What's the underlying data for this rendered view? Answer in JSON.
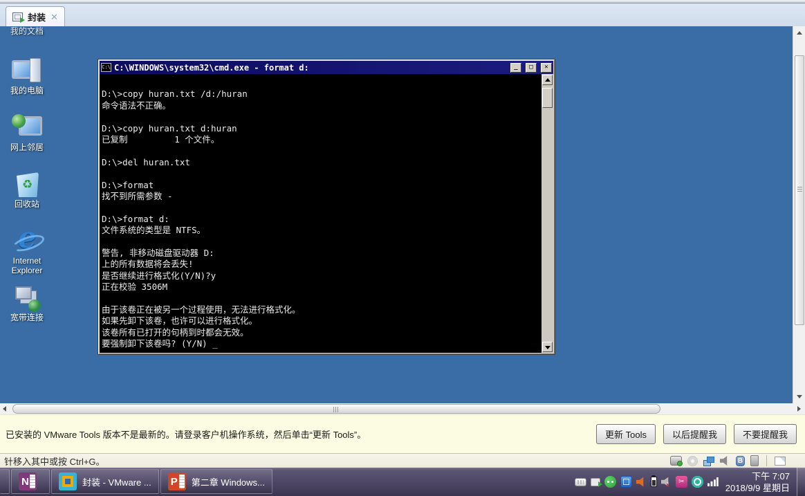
{
  "window": {
    "tab": {
      "label": "封装",
      "close_glyph": "✕"
    },
    "statusbar": {
      "message": "针移入其中或按 Ctrl+G。"
    },
    "toolsbar": {
      "message": "已安装的 VMware Tools 版本不是最新的。请登录客户机操作系统，然后单击“更新 Tools”。",
      "buttons": [
        {
          "label": "更新 Tools",
          "name": "update-tools-button"
        },
        {
          "label": "以后提醒我",
          "name": "remind-later-button"
        },
        {
          "label": "不要提醒我",
          "name": "never-remind-button"
        }
      ]
    },
    "device_icons": [
      {
        "name": "hard-disk-icon",
        "type": "dev-hdd"
      },
      {
        "name": "cd-rom-icon",
        "type": "dev-cd"
      },
      {
        "name": "network-adapter-icon",
        "type": "dev-net"
      },
      {
        "name": "sound-icon",
        "type": "dev-sound"
      },
      {
        "name": "bluetooth-icon",
        "type": "dev-bt",
        "glyph": "B"
      },
      {
        "name": "usb-icon",
        "type": "dev-usb"
      },
      {
        "name": "divider",
        "type": "dev-sep"
      },
      {
        "name": "message-log-icon",
        "type": "dev-note"
      }
    ]
  },
  "desktop": {
    "icons": [
      {
        "label": "我的文档",
        "type": "my-documents",
        "icon": "my-documents-icon"
      },
      {
        "label": "我的电脑",
        "type": "my-computer",
        "icon": "my-computer-icon"
      },
      {
        "label": "网上邻居",
        "type": "network-places",
        "icon": "network-places-icon"
      },
      {
        "label": "回收站",
        "type": "recycle-bin",
        "icon": "recycle-bin-icon"
      },
      {
        "label": "Internet Explorer",
        "type": "internet-explorer",
        "icon": "internet-explorer-icon"
      },
      {
        "label": "宽带连接",
        "type": "broadband",
        "icon": "broadband-connection-icon"
      }
    ]
  },
  "cmd": {
    "title": "C:\\WINDOWS\\system32\\cmd.exe - format d:",
    "icon_text": "C:\\",
    "buttons": {
      "minimize": "_",
      "maximize": "□",
      "close": "✕"
    },
    "lines": [
      "",
      "D:\\>copy huran.txt /d:/huran",
      "命令语法不正确。",
      "",
      "D:\\>copy huran.txt d:huran",
      "已复制         1 个文件。",
      "",
      "D:\\>del huran.txt",
      "",
      "D:\\>format",
      "找不到所需参数 -",
      "",
      "D:\\>format d:",
      "文件系统的类型是 NTFS。",
      "",
      "警告, 非移动磁盘驱动器 D:",
      "上的所有数据将会丢失!",
      "是否继续进行格式化(Y/N)?y",
      "正在校验 3506M",
      "",
      "由于该卷正在被另一个过程使用，无法进行格式化。",
      "如果先卸下该卷，也许可以进行格式化。",
      "该卷所有已打开的句柄到时都会无效。",
      "要强制卸下该卷吗? (Y/N) _"
    ]
  },
  "taskbar": {
    "buttons": [
      {
        "label": "",
        "app": "app-partial",
        "name": "taskbar-button-partial",
        "glyph": ""
      },
      {
        "label": "",
        "app": "app-onenote",
        "name": "onenote-taskbar-button",
        "glyph": "N"
      },
      {
        "label": "封装 - VMware ...",
        "app": "app-vmware",
        "name": "vmware-taskbar-button",
        "state": "active",
        "glyph": ""
      },
      {
        "label": "第二章 Windows...",
        "app": "app-powerpoint",
        "name": "powerpoint-taskbar-button",
        "glyph": "P"
      }
    ],
    "tray": [
      {
        "name": "touch-keyboard-icon",
        "type": "tr-keyboard",
        "glyph": ""
      },
      {
        "name": "vmware-tray-icon",
        "type": "tr-vmware",
        "glyph": ""
      },
      {
        "name": "wechat-icon",
        "type": "tr-wechat",
        "glyph": ""
      },
      {
        "name": "blue-app-icon",
        "type": "tr-bluebox",
        "glyph": ""
      },
      {
        "name": "sound-app-icon",
        "type": "tr-speaker",
        "glyph": ""
      },
      {
        "name": "battery-icon",
        "type": "tr-battery",
        "glyph": ""
      },
      {
        "name": "volume-muted-icon",
        "type": "tr-muted",
        "glyph": ""
      },
      {
        "name": "screenshot-tool-icon",
        "type": "tr-cut",
        "glyph": "✂"
      },
      {
        "name": "camera-app-icon",
        "type": "tr-cam",
        "glyph": ""
      },
      {
        "name": "network-signal-icon",
        "type": "tr-signal",
        "glyph": ""
      }
    ],
    "clock": {
      "time": "下午 7:07",
      "date": "2018/9/9 星期日"
    }
  }
}
